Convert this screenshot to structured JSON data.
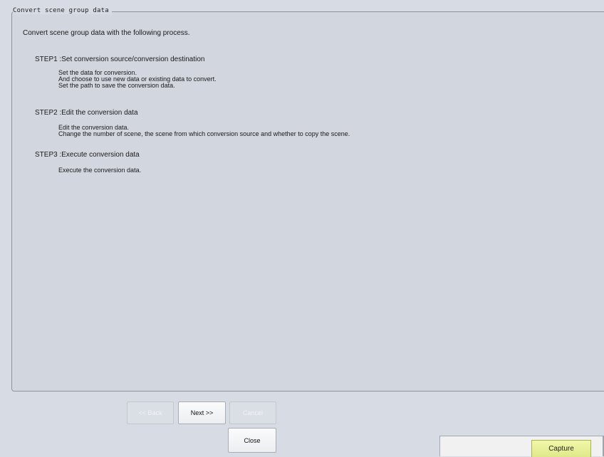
{
  "group": {
    "title": "Convert scene group data",
    "intro": "Convert scene group data with the following process."
  },
  "steps": [
    {
      "title": "STEP1 :Set conversion source/conversion destination",
      "lines": [
        "Set the data for conversion.",
        "And choose to use new data or existing data to convert.",
        "Set the path to save the conversion data."
      ]
    },
    {
      "title": "STEP2 :Edit the conversion data",
      "lines": [
        "Edit the conversion data.",
        "Change the number of scene, the scene from which conversion source and whether to copy the scene."
      ]
    },
    {
      "title": "STEP3 :Execute conversion data",
      "lines": [
        "Execute the conversion data."
      ]
    }
  ],
  "buttons": {
    "back": "<< Back",
    "next": "Next >>",
    "cancel": "Cancel",
    "close": "Close",
    "capture": "Capture"
  }
}
